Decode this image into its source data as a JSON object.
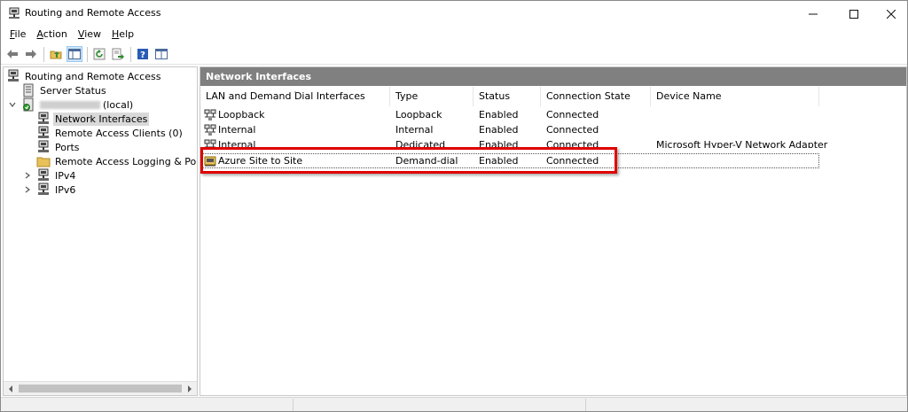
{
  "window": {
    "title": "Routing and Remote Access",
    "controls": {
      "minimize": "—",
      "maximize": "☐",
      "close": "✕"
    }
  },
  "menu": {
    "items": [
      {
        "label": "File",
        "mnemonic": "F",
        "rest": "ile"
      },
      {
        "label": "Action",
        "mnemonic": "A",
        "rest": "ction"
      },
      {
        "label": "View",
        "mnemonic": "V",
        "rest": "iew"
      },
      {
        "label": "Help",
        "mnemonic": "H",
        "rest": "elp"
      }
    ]
  },
  "toolbar": {
    "buttons": [
      "back-arrow-icon",
      "forward-arrow-icon",
      "up-folder-icon",
      "show-hide-tree-icon",
      "refresh-icon",
      "export-list-icon",
      "help-icon",
      "properties-icon"
    ]
  },
  "tree": {
    "root": "Routing and Remote Access",
    "server_status": "Server Status",
    "server_suffix": "(local)",
    "children": {
      "network_interfaces": "Network Interfaces",
      "remote_access_clients": "Remote Access Clients (0)",
      "ports": "Ports",
      "logging": "Remote Access Logging & Policies",
      "ipv4": "IPv4",
      "ipv6": "IPv6"
    }
  },
  "details": {
    "header": "Network Interfaces",
    "columns": [
      "LAN and Demand Dial Interfaces",
      "Type",
      "Status",
      "Connection State",
      "Device Name"
    ],
    "rows": [
      {
        "name": "Loopback",
        "type": "Loopback",
        "status": "Enabled",
        "state": "Connected",
        "device": ""
      },
      {
        "name": "Internal",
        "type": "Internal",
        "status": "Enabled",
        "state": "Connected",
        "device": ""
      },
      {
        "name": "Internal",
        "type": "Dedicated",
        "status": "Enabled",
        "state": "Connected",
        "device": "Microsoft Hyper-V Network Adapter"
      },
      {
        "name": "Azure Site to Site",
        "type": "Demand-dial",
        "status": "Enabled",
        "state": "Connected",
        "device": ""
      }
    ]
  },
  "colors": {
    "header_bg": "#808080",
    "highlight": "#e00000",
    "selection": "#d9d9d9"
  }
}
